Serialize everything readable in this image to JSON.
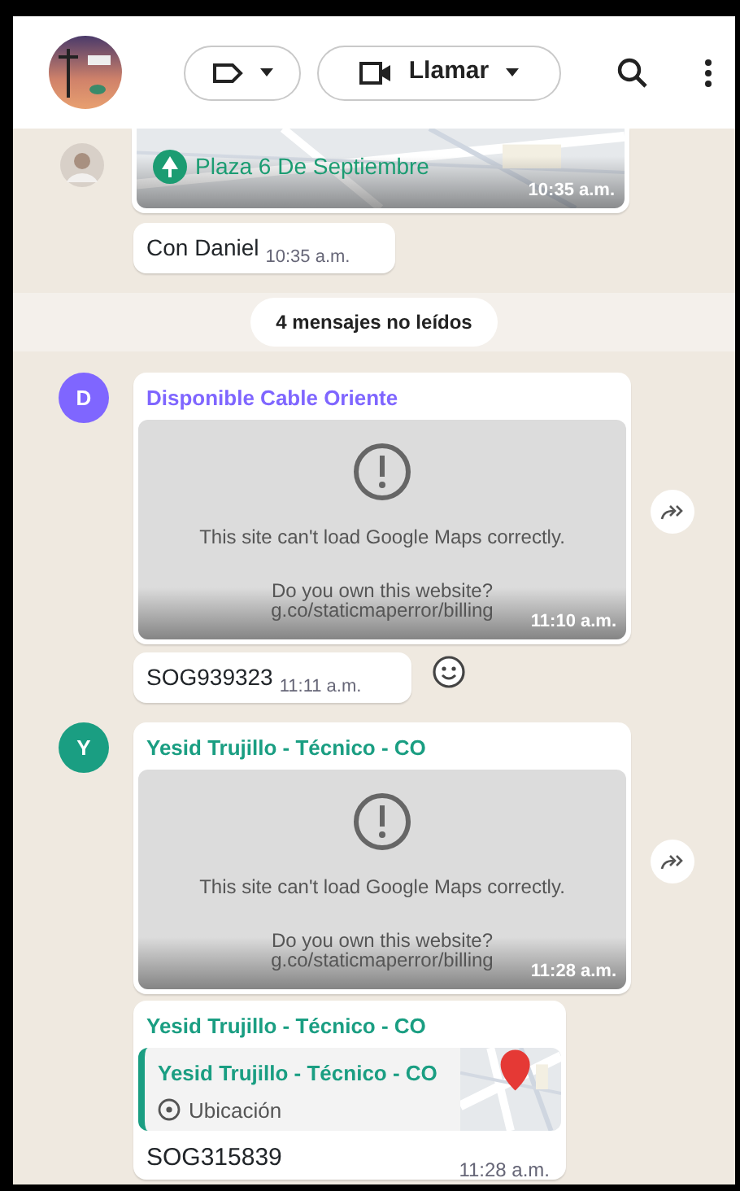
{
  "header": {
    "call_button": {
      "label": "Llamar"
    }
  },
  "messages": [
    {
      "kind": "location_map",
      "place": "Plaza 6 De Septiembre",
      "time": "10:35 a.m."
    },
    {
      "kind": "text",
      "text": "Con Daniel",
      "time": "10:35 a.m.",
      "react_button": false
    },
    {
      "kind": "unread_divider",
      "text": "4 mensajes no leídos"
    },
    {
      "kind": "map_error",
      "avatar_letter": "D",
      "sender": "Disponible Cable Oriente",
      "color": "#7f66ff",
      "error_text": "This site can't load Google Maps correctly.",
      "owner_text": "Do you own this website?",
      "billing_text": "g.co/staticmaperror/billing",
      "time": "11:10 a.m."
    },
    {
      "kind": "text",
      "text": "SOG939323",
      "time": "11:11 a.m.",
      "react_button": true
    },
    {
      "kind": "map_error",
      "avatar_letter": "Y",
      "sender": "Yesid Trujillo - Técnico - CO",
      "color": "#1a9e82",
      "error_text": "This site can't load Google Maps correctly.",
      "owner_text": "Do you own this website?",
      "billing_text": "g.co/staticmaperror/billing",
      "time": "11:28 a.m."
    },
    {
      "kind": "reply_location",
      "sender": "Yesid Trujillo - Técnico - CO",
      "color": "#1a9e82",
      "quote_sender": "Yesid Trujillo - Técnico - CO",
      "quote_label": "Ubicación",
      "text": "SOG315839",
      "time": "11:28 a.m."
    }
  ]
}
